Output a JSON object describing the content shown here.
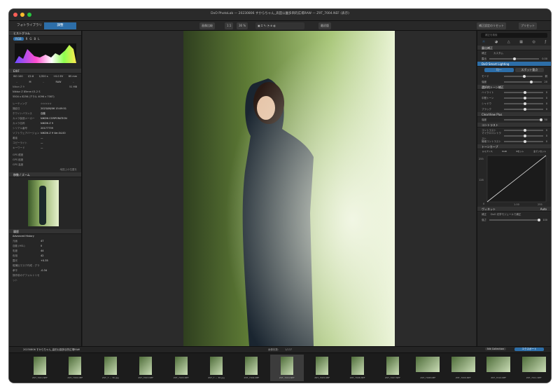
{
  "window": {
    "title": "DxO PhotoLab — 20230806 すからちゃん_高田公園多目的広場RAW — Z9T_7004.NEF (表示)"
  },
  "tabs": {
    "library": "フォトライブラリ",
    "customize": "調整"
  },
  "toolbar": {
    "compare": "画像比較",
    "fit_label": "1:1",
    "zoom": "36 %",
    "preview": "最初版",
    "apply_preset": "補正設定のリセット",
    "preset": "プリセット"
  },
  "left": {
    "histogram": "ヒストグラム",
    "channels": [
      "RGB",
      "R",
      "G",
      "B",
      "L"
    ],
    "exif": "EXIF",
    "exif_values": [
      "ISO 100",
      "f/2.8",
      "1/320 s",
      "+0.0 EV",
      "85 mm"
    ],
    "exif_modes": [
      "-",
      "M",
      "-",
      "RAW",
      "-"
    ],
    "camera": "Nikon Z 9",
    "size": "51 MB",
    "lens": "Nikkor Z 85mm f/1.2 S",
    "dims": "5504 x 8256 (デラル 4096 x 7087)",
    "metadata": [
      {
        "k": "レーティング",
        "v": "☆☆☆☆☆"
      },
      {
        "k": "撮影日",
        "v": "2023/08/06 15:09:51"
      },
      {
        "k": "ホワイトバランス",
        "v": "自動"
      },
      {
        "k": "カメラ製造メーカー",
        "v": "NIKON CORPORATION"
      },
      {
        "k": "カメラ名称",
        "v": "NIKON Z 9"
      },
      {
        "k": "シリアル番号",
        "v": "20177739"
      },
      {
        "k": "ソフトウェアバージョン",
        "v": "NIKON Z 9 Ver.04.00"
      },
      {
        "k": "著者",
        "v": "—"
      },
      {
        "k": "コピーライト",
        "v": "—"
      },
      {
        "k": "キーワード",
        "v": "—"
      }
    ],
    "gps": [
      {
        "k": "GPS 緯度",
        "v": ""
      },
      {
        "k": "GPS 経度",
        "v": ""
      },
      {
        "k": "GPS 高度",
        "v": ""
      }
    ],
    "gps_link": "地図上の位置を",
    "loupe": "移動 / ズーム",
    "history_title": "履歴",
    "history_mode": "Advanced History",
    "history": [
      {
        "k": "元画",
        "v": "47"
      },
      {
        "k": "自動 (HSL)",
        "v": "0"
      },
      {
        "k": "彩度",
        "v": "44"
      },
      {
        "k": "色相",
        "v": "42"
      },
      {
        "k": "露光",
        "v": "+0.35"
      },
      {
        "k": "縦横比マスク作成 - グラデ",
        "v": ""
      },
      {
        "k": "水平",
        "v": "-0.34"
      },
      {
        "k": "操作前のデフォルトリセット",
        "v": ""
      }
    ]
  },
  "right": {
    "search_placeholder": "補正を検索",
    "section1": "露出補正",
    "mode_label": "補正",
    "mode_value": "カスタム",
    "ev_label": "露出",
    "ev_value": "0.00",
    "smart": "DxO Smart Lighting",
    "smart_tabs": [
      "均一",
      "スポット重点"
    ],
    "smart_rows": [
      {
        "k": "モード",
        "v": "弱"
      },
      {
        "k": "強度",
        "v": "20"
      }
    ],
    "tone_title": "選択的トーン補正",
    "tone_rows": [
      {
        "k": "ハイライト",
        "v": "0"
      },
      {
        "k": "中間トーン",
        "v": "0"
      },
      {
        "k": "シャドウ",
        "v": "0"
      },
      {
        "k": "ブラック",
        "v": "0"
      }
    ],
    "clear_title": "ClearView Plus",
    "clear_rows": [
      {
        "k": "強度",
        "v": "50"
      }
    ],
    "contrast_title": "コントラスト",
    "contrast_rows": [
      {
        "k": "コントラスト",
        "v": "0"
      },
      {
        "k": "マイクロコントラスト",
        "v": "0"
      },
      {
        "k": "微細コントラスト",
        "v": "0"
      }
    ],
    "curve_title": "トーンカーブ",
    "curve_tabs": [
      "ルミナンス",
      "RGB",
      "Rセット",
      "全てリセット"
    ],
    "curve_vals": [
      "255",
      "128",
      "0",
      "1.00",
      "255"
    ],
    "vignette": "ヴィネット",
    "vignette_mode": "Auto",
    "vignette_rows": [
      {
        "k": "補正",
        "v": "DxO 光学モジュールで補正"
      },
      {
        "k": "強さ",
        "v": "100"
      }
    ]
  },
  "filmstrip": {
    "folder": "20230806 すからちゃん_高田公園多目的広場RAW",
    "count_label": "画像枚数:",
    "count": "1/137",
    "collection": "Nik Collection",
    "export": "エクスポート",
    "items": [
      "Z9T_7001.NEF",
      "Z9T_7002.NEF",
      "Z9T_7 — 36.jpg",
      "Z9T_7003.NEF",
      "Z9T_7003.NEF",
      "Z9T_7 — 36.jpg",
      "Z9T_7004.NEF",
      "Z9T_7004.NEF",
      "Z9T_7005.NEF",
      "Z9T_7006.NEF",
      "Z9T_7007.NEF",
      "Z9T_7008.NEF",
      "Z9T_7009.NEF",
      "Z9T_7010.NEF",
      "Z9T_7011.NEF"
    ]
  },
  "colors": {
    "accent": "#2d6ea8",
    "panel": "#262626"
  }
}
